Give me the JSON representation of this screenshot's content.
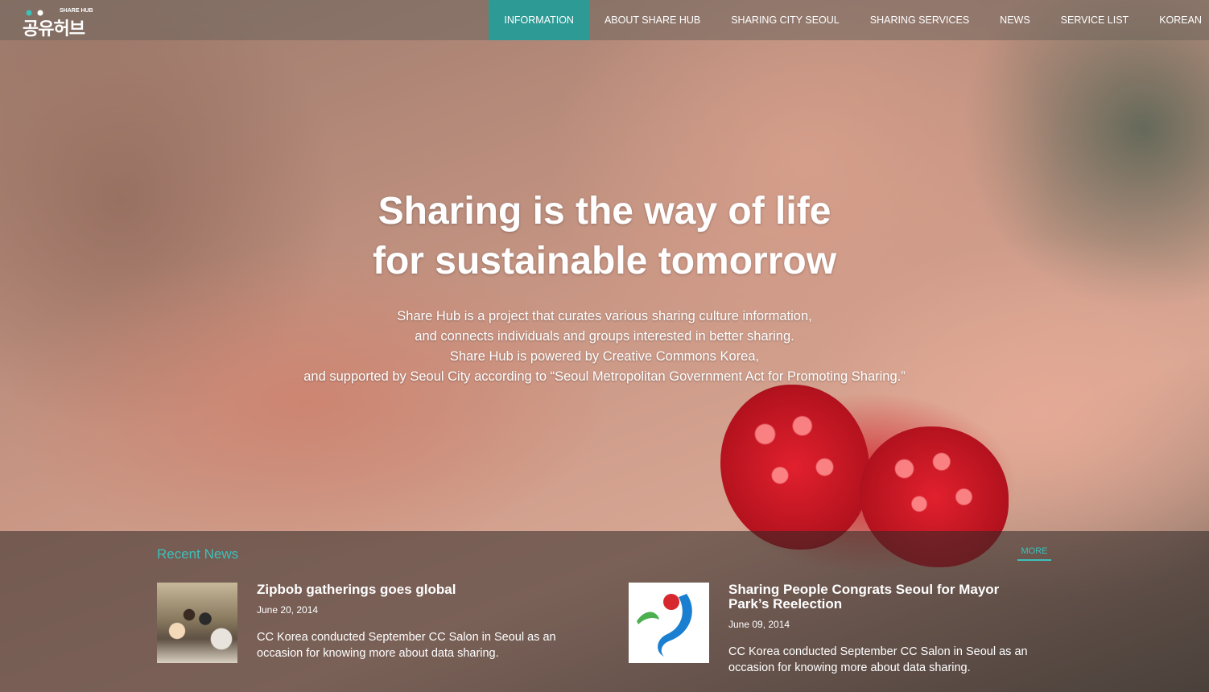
{
  "header": {
    "logo_text": "공유허브",
    "logo_subtext": "SHARE HUB",
    "nav": [
      {
        "label": "INFORMATION",
        "active": true
      },
      {
        "label": "ABOUT SHARE HUB",
        "active": false
      },
      {
        "label": "SHARING CITY SEOUL",
        "active": false
      },
      {
        "label": "SHARING SERVICES",
        "active": false
      },
      {
        "label": "NEWS",
        "active": false
      },
      {
        "label": "SERVICE LIST",
        "active": false
      },
      {
        "label": "KOREAN",
        "active": false
      }
    ]
  },
  "hero": {
    "title_line1": "Sharing is the way of life",
    "title_line2": "for sustainable tomorrow",
    "desc_line1": "Share Hub is a project that curates various sharing culture information,",
    "desc_line2": "and connects individuals and groups interested in better sharing.",
    "desc_line3": "Share Hub is powered by Creative Commons Korea,",
    "desc_line4": "and supported by Seoul City according to “Seoul Metropolitan Government Act for Promoting Sharing.”"
  },
  "news": {
    "heading": "Recent News",
    "more_label": "MORE",
    "items": [
      {
        "title": "Zipbob gatherings goes global",
        "date": "June 20, 2014",
        "excerpt": "CC Korea conducted September CC Salon in Seoul as an occasion for knowing more about data sharing."
      },
      {
        "title": "Sharing People Congrats Seoul for Mayor Park’s Reelection",
        "date": "June 09, 2014",
        "excerpt": "CC Korea conducted September CC Salon in Seoul as an occasion for knowing more about data sharing."
      }
    ]
  },
  "colors": {
    "accent": "#2d9a95",
    "accent_text": "#3cc1bb"
  }
}
